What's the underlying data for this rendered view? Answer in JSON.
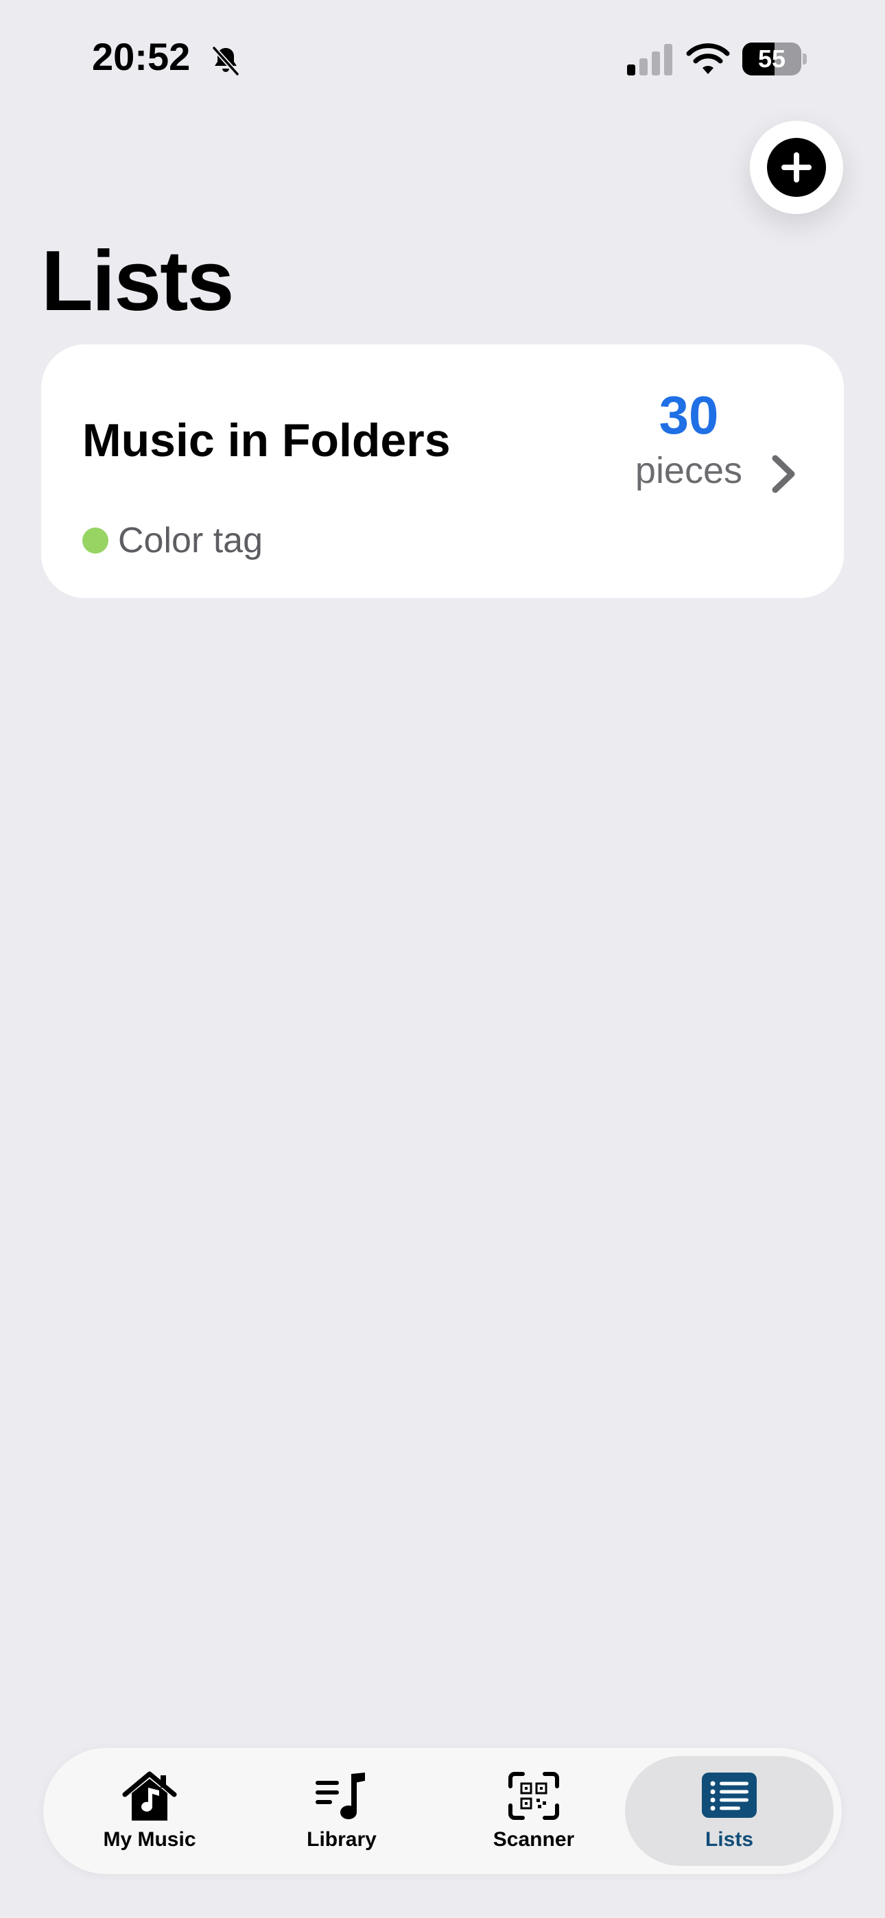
{
  "status_bar": {
    "time": "20:52",
    "battery_level": "55",
    "battery_fraction": 0.55,
    "bell_icon": "bell-slash-icon",
    "signal_icon": "cellular-signal-icon",
    "wifi_icon": "wifi-icon"
  },
  "header": {
    "title": "Lists",
    "add_icon": "plus-circle-icon"
  },
  "lists": [
    {
      "name": "Music in Folders",
      "count": "30",
      "count_unit": "pieces",
      "tag_label": "Color tag",
      "tag_color": "#97D464",
      "chevron_icon": "chevron-right-icon"
    }
  ],
  "tab_bar": {
    "active": "Lists",
    "tabs": [
      {
        "label": "My Music",
        "icon": "house-music-icon"
      },
      {
        "label": "Library",
        "icon": "music-list-icon"
      },
      {
        "label": "Scanner",
        "icon": "qr-scan-icon"
      },
      {
        "label": "Lists",
        "icon": "list-icon"
      }
    ]
  },
  "colors": {
    "background": "#EBEBF0",
    "accent_blue": "#1F6FE5",
    "active_tab": "#104D78",
    "text_primary": "#000000",
    "text_secondary": "#6C6C70"
  }
}
